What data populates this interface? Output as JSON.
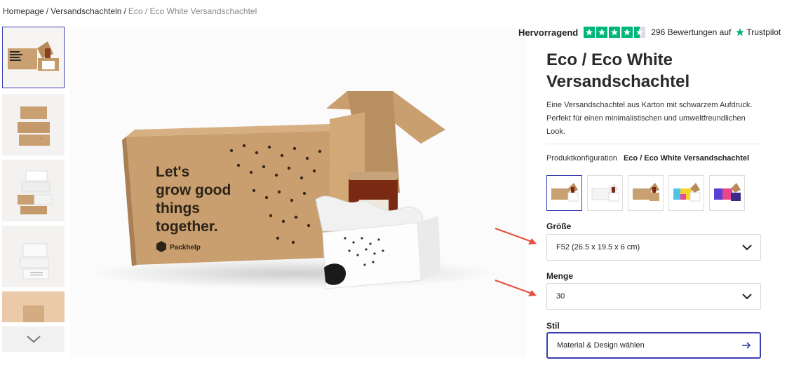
{
  "breadcrumb": {
    "items": [
      "Homepage",
      "Versandschachteln"
    ],
    "separator": "/",
    "current": "Eco / Eco White Versandschachtel"
  },
  "trustpilot": {
    "rating_label": "Hervorragend",
    "stars": 4.5,
    "reviews_text": "296 Bewertungen auf",
    "brand": "Trustpilot",
    "star_color": "#00b67a"
  },
  "product": {
    "title": "Eco / Eco White Versandschachtel",
    "description": "Eine Versandschachtel aus Karton mit schwarzem Aufdruck. Perfekt für einen minimalistischen und umweltfreundlichen Look.",
    "config_label": "Produktkonfiguration",
    "config_value": "Eco / Eco White Versandschachtel"
  },
  "hero_image": {
    "box_text": "Let's grow good things together.",
    "brand": "Packhelp"
  },
  "thumbnails": {
    "count": 5,
    "active_index": 0
  },
  "variants": {
    "count": 5,
    "active_index": 0
  },
  "size": {
    "label": "Größe",
    "value": "F52 (26.5 x 19.5 x 6 cm)"
  },
  "quantity": {
    "label": "Menge",
    "value": "30"
  },
  "style": {
    "label": "Stil",
    "button_label": "Material & Design wählen"
  },
  "colors": {
    "accent": "#3a3fb0",
    "annotation": "#e8513f",
    "kraft": "#c9a072"
  }
}
